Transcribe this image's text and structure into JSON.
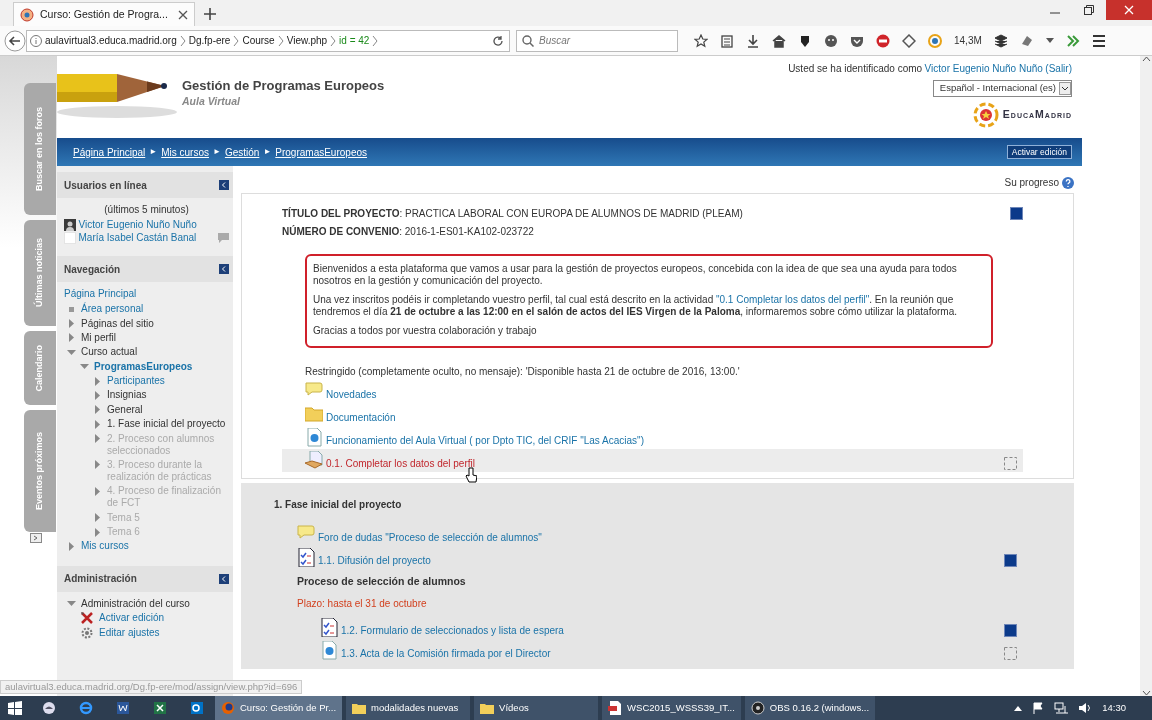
{
  "browser": {
    "tab_title": "Curso: Gestión de Progra...",
    "url_host": "aulavirtual3.educa.madrid.org",
    "url_path": [
      "Dg.fp-ere",
      "Course",
      "View.php",
      "id = 42"
    ],
    "search_placeholder": "Buscar",
    "toolbar_badge": "14,3M"
  },
  "side_tabs": [
    "Buscar en los foros",
    "Últimas noticias",
    "Calendario",
    "Eventos próximos"
  ],
  "header": {
    "title": "Gestión de Programas Europeos",
    "subtitle": "Aula Virtual",
    "login_text": "Usted se ha identificado como",
    "login_user": "Victor Eugenio Nuño Nuño",
    "logout": "(Salir)",
    "language": "Español - Internacional (es)",
    "logo": "EducaMadrid"
  },
  "breadcrumb": {
    "items": [
      "Página Principal",
      "Mis cursos",
      "Gestión",
      "ProgramasEuropeos"
    ],
    "separator": "►",
    "edit_button": "Activar edición"
  },
  "sidebar": {
    "online": {
      "title": "Usuarios en línea",
      "note": "(últimos 5 minutos)",
      "users": [
        {
          "name": "Victor Eugenio Nuño Nuño",
          "has_photo": true,
          "can_message": false
        },
        {
          "name": "María Isabel Castán Banal",
          "has_photo": false,
          "can_message": true
        }
      ]
    },
    "navigation": {
      "title": "Navegación",
      "root": "Página Principal",
      "items": [
        {
          "label": "Área personal",
          "kind": "bullet",
          "link": true,
          "dimmed": false,
          "selected": false
        },
        {
          "label": "Páginas del sitio",
          "kind": "node",
          "expanded": false,
          "link": false,
          "dimmed": false,
          "selected": false
        },
        {
          "label": "Mi perfil",
          "kind": "node",
          "expanded": false,
          "link": false,
          "dimmed": false,
          "selected": false
        },
        {
          "label": "Curso actual",
          "kind": "node",
          "expanded": true,
          "link": false,
          "dimmed": false,
          "selected": false,
          "children": [
            {
              "label": "ProgramasEuropeos",
              "kind": "node",
              "expanded": true,
              "link": true,
              "dimmed": false,
              "selected": true,
              "children": [
                {
                  "label": "Participantes",
                  "kind": "node",
                  "expanded": false,
                  "link": true,
                  "dimmed": false,
                  "selected": false
                },
                {
                  "label": "Insignias",
                  "kind": "node",
                  "expanded": false,
                  "link": false,
                  "dimmed": false,
                  "selected": false
                },
                {
                  "label": "General",
                  "kind": "node",
                  "expanded": false,
                  "link": false,
                  "dimmed": false,
                  "selected": false
                },
                {
                  "label": "1. Fase inicial del proyecto",
                  "kind": "node",
                  "expanded": false,
                  "link": false,
                  "dimmed": false,
                  "selected": false
                },
                {
                  "label": "2. Proceso con alumnos seleccionados",
                  "kind": "node",
                  "expanded": false,
                  "link": false,
                  "dimmed": true,
                  "selected": false
                },
                {
                  "label": "3. Proceso durante la realización de prácticas",
                  "kind": "node",
                  "expanded": false,
                  "link": false,
                  "dimmed": true,
                  "selected": false
                },
                {
                  "label": "4. Proceso de finalización de FCT",
                  "kind": "node",
                  "expanded": false,
                  "link": false,
                  "dimmed": true,
                  "selected": false
                },
                {
                  "label": "Tema 5",
                  "kind": "node",
                  "expanded": false,
                  "link": false,
                  "dimmed": true,
                  "selected": false
                },
                {
                  "label": "Tema 6",
                  "kind": "node",
                  "expanded": false,
                  "link": false,
                  "dimmed": true,
                  "selected": false
                }
              ]
            }
          ]
        },
        {
          "label": "Mis cursos",
          "kind": "node",
          "expanded": false,
          "link": true,
          "dimmed": false,
          "selected": false
        }
      ]
    },
    "admin": {
      "title": "Administración",
      "items": [
        {
          "label": "Administración del curso",
          "kind": "node",
          "expanded": true,
          "link": false,
          "dimmed": false,
          "selected": false,
          "children": [
            {
              "label": "Activar edición",
              "kind": "tools",
              "link": true,
              "dimmed": false,
              "selected": false
            },
            {
              "label": "Editar ajustes",
              "kind": "gear",
              "link": true,
              "dimmed": false,
              "selected": false
            }
          ]
        }
      ]
    }
  },
  "progress": {
    "label": "Su progreso"
  },
  "sections": [
    {
      "highlighted": false,
      "items": [
        {
          "kind": "field",
          "text": "**TÍTULO DEL PROYECTO**: PRACTICA LABORAL CON EUROPA DE ALUMNOS DE MADRID (PLEAM)",
          "completed": true
        },
        {
          "kind": "field",
          "text": "**NÚMERO DE CONVENIO**: 2016-1-ES01-KA102-023722"
        },
        {
          "kind": "notice",
          "paragraphs": [
            [
              {
                "kind": "text",
                "text": "Bienvenidos a esta plataforma que vamos a usar para la gestión de proyectos europeos, concebida con la idea de que sea una ayuda para todos nosotros en la gestión y comunicación del proyecto."
              }
            ],
            [
              {
                "kind": "text",
                "text": "Una vez inscritos podéis ir completando vuestro perfil, tal cual está descrito en la actividad "
              },
              {
                "kind": "link",
                "text": "\"0.1 Completar los datos del perfil\""
              },
              {
                "kind": "text",
                "text": ". En la reunión que tendremos el día **21 de octubre a las 12:00 en el salón de actos del IES Virgen de la Paloma**, informaremos sobre cómo utilizar la plataforma."
              }
            ],
            [
              {
                "kind": "text",
                "text": "Gracias a todos por vuestra colaboración y trabajo"
              }
            ]
          ]
        },
        {
          "kind": "restriction",
          "text": "Restringido (completamente oculto, no mensaje): 'Disponible hasta 21 de octubre de 2016, 13:00.'"
        },
        {
          "kind": "forum",
          "label": "Novedades",
          "hovered": false,
          "indented": false
        },
        {
          "kind": "folder",
          "label": "Documentación",
          "hovered": false,
          "indented": false
        },
        {
          "kind": "page",
          "label": "Funcionamiento del Aula Virtual ( por Dpto TIC, del CRIF \"Las Acacias\")",
          "hovered": false,
          "indented": false
        },
        {
          "kind": "assign",
          "label": "0.1. Completar los datos del perfil",
          "hovered": true,
          "indented": false,
          "completed": false
        }
      ]
    },
    {
      "highlighted": true,
      "title": "1. Fase inicial del proyecto",
      "items": [
        {
          "kind": "forum",
          "label": "Foro de dudas \"Proceso de selección de alumnos\"",
          "hovered": false,
          "indented": false
        },
        {
          "kind": "checklist",
          "label": "1.1. Difusión del proyecto",
          "hovered": false,
          "indented": false,
          "completed": true
        },
        {
          "kind": "heading",
          "text": "Proceso de selección de alumnos"
        },
        {
          "kind": "note",
          "text": "Plazo: hasta el 31 de octubre"
        },
        {
          "kind": "checklist",
          "label": "1.2. Formulario de seleccionados y lista de espera",
          "hovered": false,
          "indented": true,
          "completed": true
        },
        {
          "kind": "page",
          "label": "1.3. Acta de la Comisión firmada por el Director",
          "hovered": false,
          "indented": true,
          "completed": false
        }
      ]
    }
  ],
  "status_url": "aulavirtual3.educa.madrid.org/Dg.fp-ere/mod/assign/view.php?id=696",
  "taskbar": {
    "windows": [
      {
        "label": "Curso: Gestión de Pr...",
        "kind": "browser",
        "selected": true
      },
      {
        "label": "modalidades nuevas",
        "kind": "folder",
        "selected": false
      },
      {
        "label": "Vídeos",
        "kind": "folder",
        "selected": false
      },
      {
        "label": "WSC2015_WSSS39_IT...",
        "kind": "pdf",
        "selected": false
      },
      {
        "label": "OBS 0.16.2 (windows...",
        "kind": "recorder",
        "selected": false
      }
    ],
    "time": "14:30"
  }
}
